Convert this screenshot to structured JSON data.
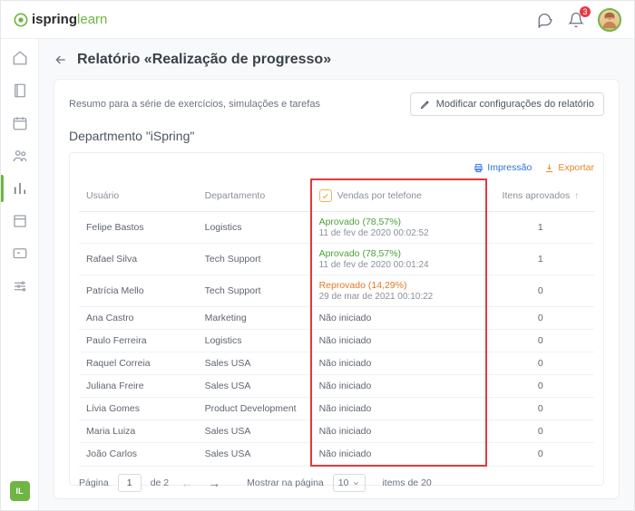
{
  "header": {
    "logo_main": "ispring",
    "logo_suffix": " learn",
    "notif_count": "3"
  },
  "sidebar": {
    "bottom_label": "IL"
  },
  "page": {
    "title": "Relatório «Realização de progresso»",
    "summary": "Resumo para a série de exercícios, simulações e tarefas",
    "edit_btn": "Modificar configurações do relatório",
    "dept_title": "Departmento \"iSpring\""
  },
  "actions": {
    "print": "Impressão",
    "export": "Exportar"
  },
  "table": {
    "cols": {
      "user": "Usuário",
      "dept": "Departamento",
      "phone": "Vendas por telefone",
      "approved": "Itens aprovados",
      "sort_indicator": "↑"
    },
    "rows": [
      {
        "user": "Felipe Bastos",
        "dept": "Logistics",
        "status": "Aprovado",
        "pct": "(78,57%)",
        "date": "11 de fev de 2020 00:02:52",
        "kind": "ok",
        "approved": "1"
      },
      {
        "user": "Rafael Silva",
        "dept": "Tech Support",
        "status": "Aprovado",
        "pct": "(78,57%)",
        "date": "11 de fev de 2020 00:01:24",
        "kind": "ok",
        "approved": "1"
      },
      {
        "user": "Patrícia Mello",
        "dept": "Tech Support",
        "status": "Reprovado",
        "pct": "(14,29%)",
        "date": "29 de mar de 2021 00:10:22",
        "kind": "bad",
        "approved": "0"
      },
      {
        "user": "Ana Castro",
        "dept": "Marketing",
        "status": "Não iniciado",
        "pct": "",
        "date": "",
        "kind": "none",
        "approved": "0"
      },
      {
        "user": "Paulo Ferreira",
        "dept": "Logistics",
        "status": "Não iniciado",
        "pct": "",
        "date": "",
        "kind": "none",
        "approved": "0"
      },
      {
        "user": "Raquel Correia",
        "dept": "Sales USA",
        "status": "Não iniciado",
        "pct": "",
        "date": "",
        "kind": "none",
        "approved": "0"
      },
      {
        "user": "Juliana Freire",
        "dept": "Sales USA",
        "status": "Não iniciado",
        "pct": "",
        "date": "",
        "kind": "none",
        "approved": "0"
      },
      {
        "user": "Lívia Gomes",
        "dept": "Product Development",
        "status": "Não iniciado",
        "pct": "",
        "date": "",
        "kind": "none",
        "approved": "0"
      },
      {
        "user": "Maria Luiza",
        "dept": "Sales USA",
        "status": "Não iniciado",
        "pct": "",
        "date": "",
        "kind": "none",
        "approved": "0"
      },
      {
        "user": "João Carlos",
        "dept": "Sales USA",
        "status": "Não iniciado",
        "pct": "",
        "date": "",
        "kind": "none",
        "approved": "0"
      }
    ]
  },
  "pager": {
    "page_label": "Página",
    "page": "1",
    "of": "de 2",
    "show_label": "Mostrar na página",
    "page_size": "10",
    "items": "items de 20"
  }
}
